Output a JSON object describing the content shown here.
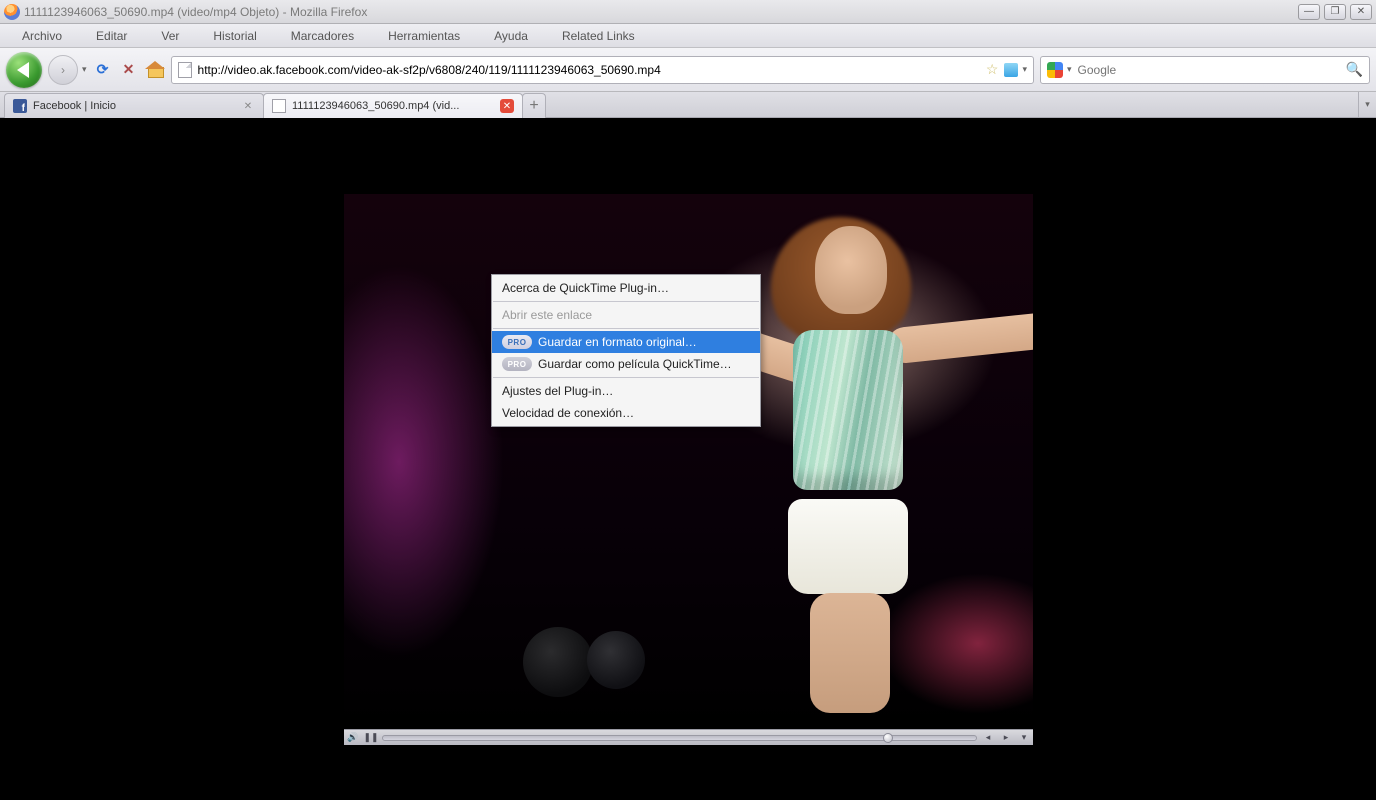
{
  "window": {
    "title": "1111123946063_50690.mp4 (video/mp4 Objeto) - Mozilla Firefox"
  },
  "menubar": {
    "items": [
      "Archivo",
      "Editar",
      "Ver",
      "Historial",
      "Marcadores",
      "Herramientas",
      "Ayuda",
      "Related Links"
    ]
  },
  "nav": {
    "url": "http://video.ak.facebook.com/video-ak-sf2p/v6808/240/119/1111123946063_50690.mp4",
    "search_placeholder": "Google"
  },
  "tabs": {
    "items": [
      {
        "label": "Facebook | Inicio",
        "active": false
      },
      {
        "label": "1111123946063_50690.mp4 (vid...",
        "active": true
      }
    ],
    "newtab": "+"
  },
  "context_menu": {
    "about": "Acerca de QuickTime Plug-in…",
    "open_link": "Abrir este enlace",
    "save_source": "Guardar en formato original…",
    "save_qt": "Guardar como película QuickTime…",
    "plugin_settings": "Ajustes del Plug-in…",
    "conn_speed": "Velocidad de conexión…",
    "pro_badge": "PRO"
  },
  "player": {
    "progress_pct": 86
  }
}
